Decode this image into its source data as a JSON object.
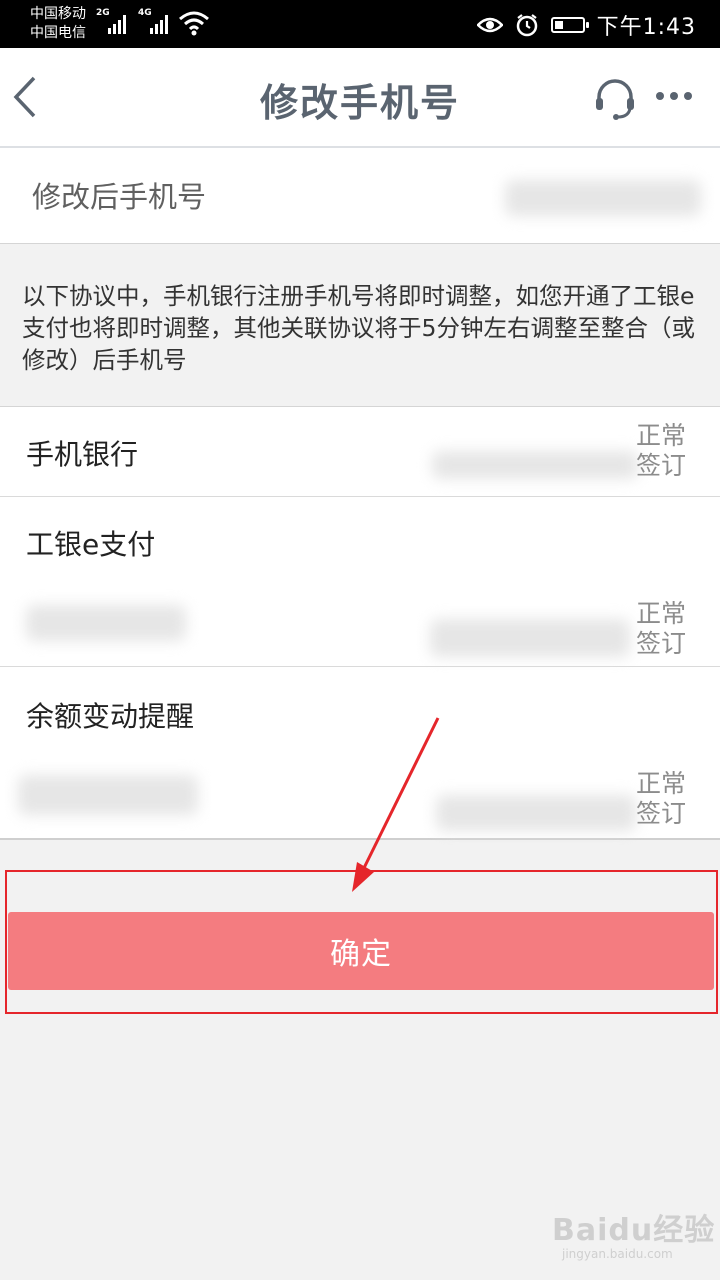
{
  "status_bar": {
    "carrier1": "中国移动",
    "carrier2": "中国电信",
    "net1": "2G",
    "net2": "4G",
    "time": "下午1:43",
    "battery_level": 0.3,
    "icons": [
      "signal-icon",
      "wifi-icon",
      "eye-icon",
      "alarm-icon",
      "battery-icon"
    ]
  },
  "header": {
    "title": "修改手机号",
    "back_icon": "back-chevron-icon",
    "service_icon": "headset-icon",
    "more_icon": "more-dots-icon"
  },
  "new_number": {
    "label": "修改后手机号"
  },
  "notice": "以下协议中，手机银行注册手机号将即时调整，如您开通了工银e支付也将即时调整，其他关联协议将于5分钟左右调整至整合（或修改）后手机号",
  "agreements": [
    {
      "name": "手机银行",
      "status_line1": "正常",
      "status_line2": "签订"
    },
    {
      "name": "工银e支付",
      "status_line1": "正常",
      "status_line2": "签订"
    },
    {
      "name": "余额变动提醒",
      "status_line1": "正常",
      "status_line2": "签订"
    }
  ],
  "confirm_label": "确定",
  "watermark": {
    "brand": "Baidu经验",
    "url": "jingyan.baidu.com"
  },
  "colors": {
    "confirm_bg": "#f47c80",
    "annotation_red": "#e5262b",
    "title_color": "#5a6470"
  }
}
